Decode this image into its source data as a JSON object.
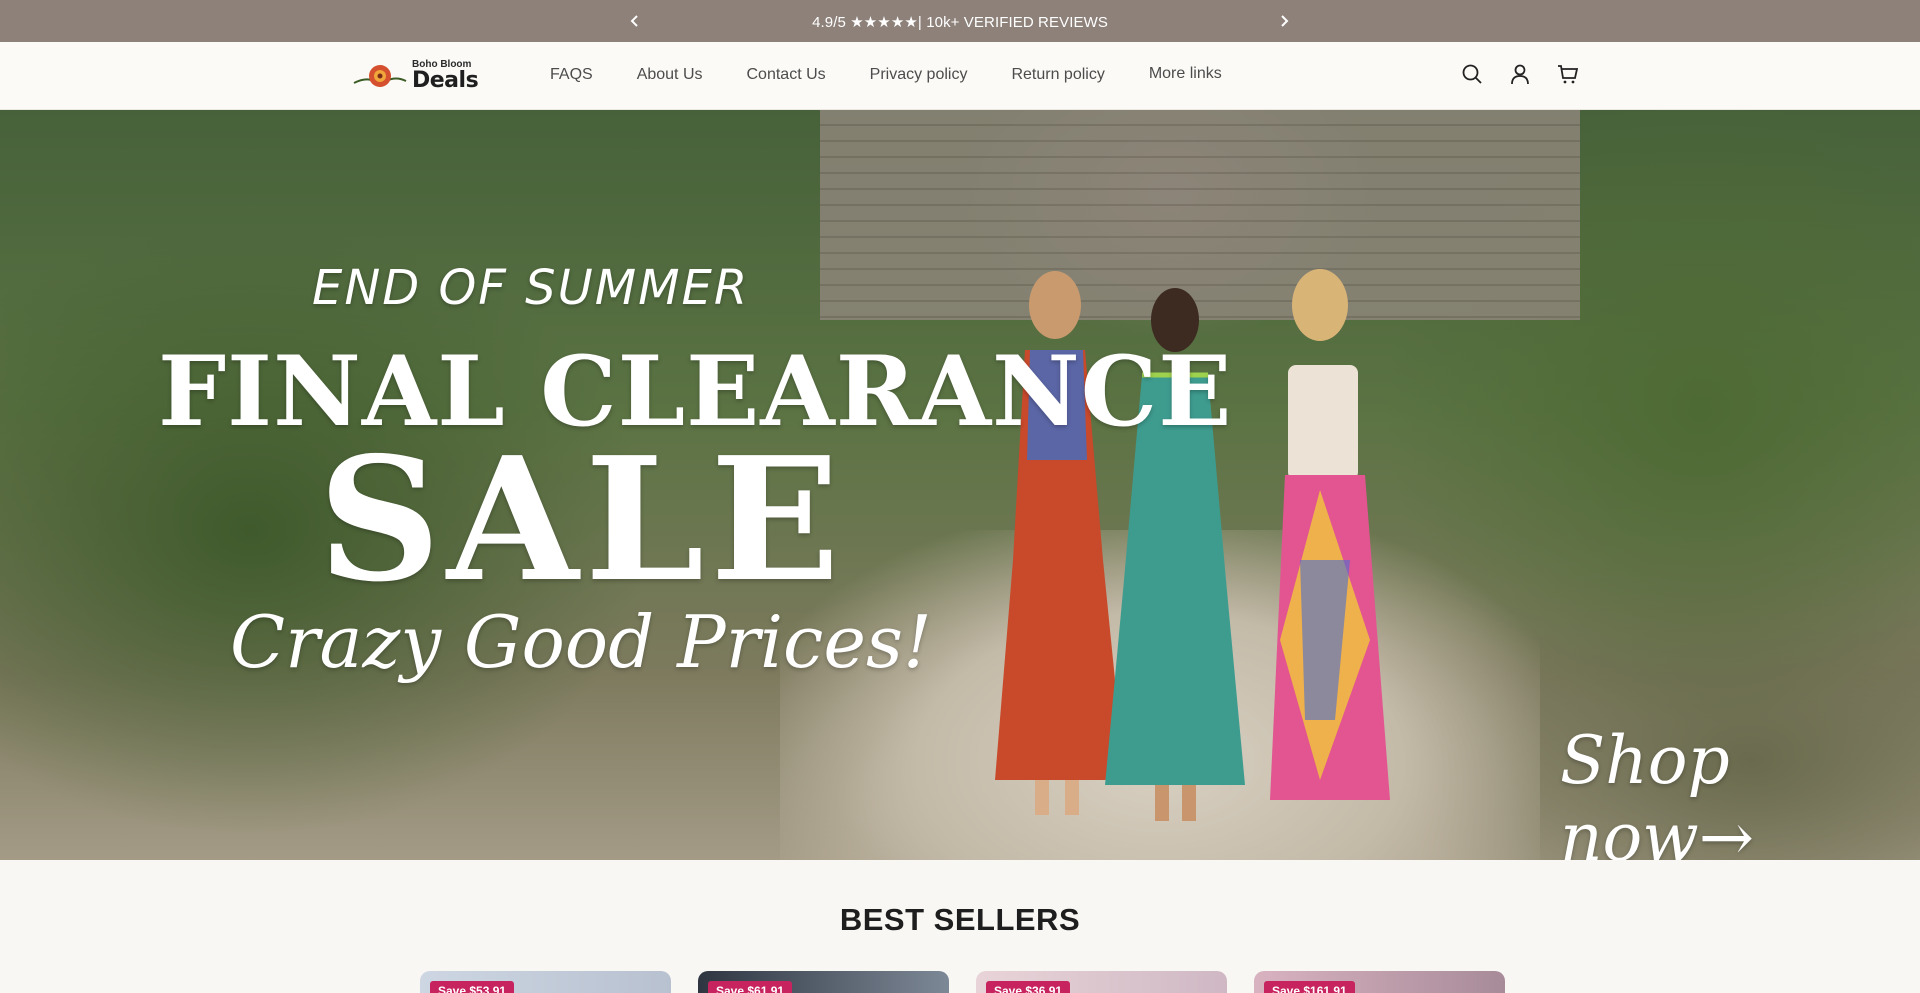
{
  "announcement": {
    "text": "4.9/5 ★★★★★| 10k+ VERIFIED REVIEWS"
  },
  "logo": {
    "top": "Boho Bloom",
    "main": "Deals"
  },
  "nav": {
    "items": [
      {
        "label": "FAQS"
      },
      {
        "label": "About Us"
      },
      {
        "label": "Contact Us"
      },
      {
        "label": "Privacy policy"
      },
      {
        "label": "Return policy"
      },
      {
        "label": "More links"
      }
    ]
  },
  "hero": {
    "line1": "END OF SUMMER",
    "line2": "FINAL CLEARANCE",
    "line3": "SALE",
    "line4": "Crazy Good Prices!",
    "cta": "Shop now→"
  },
  "best_sellers": {
    "title": "BEST SELLERS",
    "cards": [
      {
        "badge": "Save $53.91"
      },
      {
        "badge": "Save $61.91"
      },
      {
        "badge": "Save $36.91"
      },
      {
        "badge": "Save $161.91"
      }
    ]
  }
}
